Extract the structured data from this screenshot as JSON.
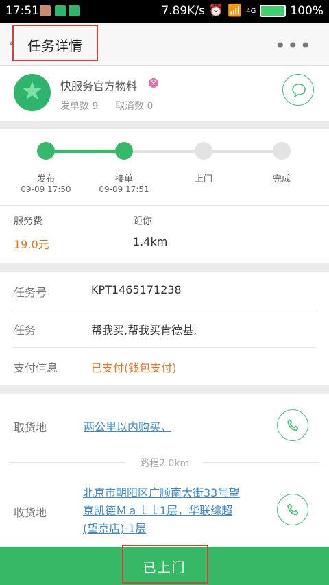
{
  "status_bar": {
    "time": "17:51",
    "speed": "7.89K/s",
    "battery": "100%",
    "network": "4G"
  },
  "nav": {
    "back_icon": "chevron-left",
    "title": "任务详情",
    "more": "•••"
  },
  "user": {
    "name": "快服务官方物料",
    "gender_icon": "♀",
    "orders_label": "发单数 9",
    "cancels_label": "取消数 0"
  },
  "progress": {
    "steps": [
      {
        "label": "发布",
        "time": "09-09 17:50"
      },
      {
        "label": "接单",
        "time": "09-09 17:51"
      },
      {
        "label": "上门",
        "time": ""
      },
      {
        "label": "完成",
        "time": ""
      }
    ],
    "completed_steps": 2
  },
  "service": {
    "fee_label": "服务费",
    "fee_value": "19.0元",
    "distance_label": "距你",
    "distance_value": "1.4km"
  },
  "task_info": {
    "id_label": "任务号",
    "id_value": "KPT1465171238",
    "task_label": "任务",
    "task_value": "帮我买,帮我买肯德基,",
    "pay_label": "支付信息",
    "pay_value": "已支付(钱包支付)"
  },
  "pickup": {
    "label": "取货地",
    "address": "两公里以内购买，"
  },
  "route": {
    "text": "路程2.0km"
  },
  "delivery": {
    "label": "收货地",
    "address_line1": "北京市朝阳区广顺南大街33号望",
    "address_line2": "京凯德Ｍａｌｌ1层，华联综超",
    "address_line3": "(望京店)-1层"
  },
  "action_button": {
    "label": "已上门"
  },
  "colors": {
    "green": "#37b866",
    "orange": "#e9731e",
    "link": "#3a8ad0",
    "highlight": "#d9403a"
  }
}
